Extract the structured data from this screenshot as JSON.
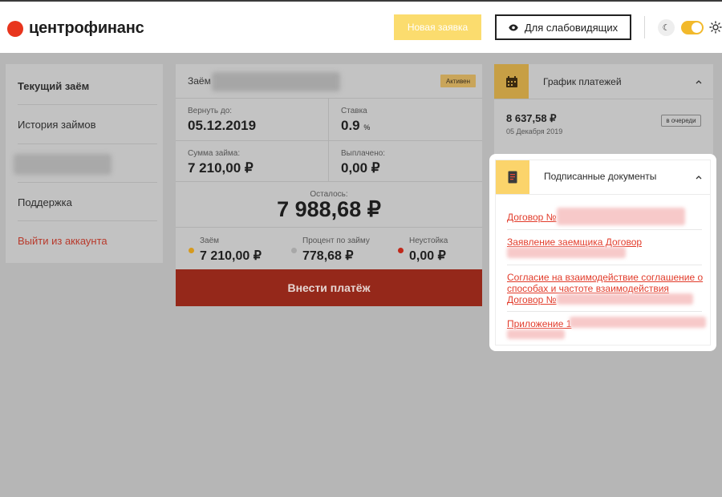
{
  "brand": {
    "name": "центрофинанс",
    "color": "#e8351d"
  },
  "header": {
    "new_request_label": "Новая заявка",
    "vision_label": "Для слабовидящих",
    "eye_icon": "eye-icon",
    "moon_icon": "moon-icon",
    "sun_icon": "sun-icon"
  },
  "sidebar": {
    "items": [
      {
        "label": "Текущий заём",
        "active": true
      },
      {
        "label": "История займов"
      },
      {
        "label": ""
      },
      {
        "label": "Поддержка"
      },
      {
        "label": "Выйти из аккаунта",
        "danger": true
      }
    ]
  },
  "loan": {
    "title_label": "Заём",
    "status_badge": "Активен",
    "return_label": "Вернуть до:",
    "return_value": "05.12.2019",
    "rate_label": "Ставка",
    "rate_value": "0.9",
    "rate_unit": "%",
    "amount_label": "Сумма займа:",
    "amount_value": "7 210,00 ₽",
    "paid_label": "Выплачено:",
    "paid_value": "0,00 ₽",
    "remaining_label": "Осталось:",
    "remaining_value": "7 988,68 ₽",
    "breakdown": [
      {
        "label": "Заём",
        "value": "7 210,00 ₽",
        "color": "#d69a1e"
      },
      {
        "label": "Процент по займу",
        "value": "778,68 ₽",
        "color": "#a8a8a8"
      },
      {
        "label": "Неустойка",
        "value": "0,00 ₽",
        "color": "#c0281a"
      }
    ],
    "pay_button": "Внести платёж"
  },
  "schedule": {
    "title": "График платежей",
    "amount": "8 637,58 ₽",
    "date": "05 Декабря 2019",
    "status": "в очереди",
    "icon": "calendar-icon"
  },
  "documents": {
    "title": "Подписанные документы",
    "icon": "document-icon",
    "links": [
      {
        "line1": "Договор №"
      },
      {
        "line1": "Заявление заемщика Договор"
      },
      {
        "line1": "Согласие на взаимодействие соглашение о",
        "line2": "способах и частоте взаимодействия",
        "line3": "Договор №"
      },
      {
        "line1": "Приложение 1"
      }
    ]
  }
}
